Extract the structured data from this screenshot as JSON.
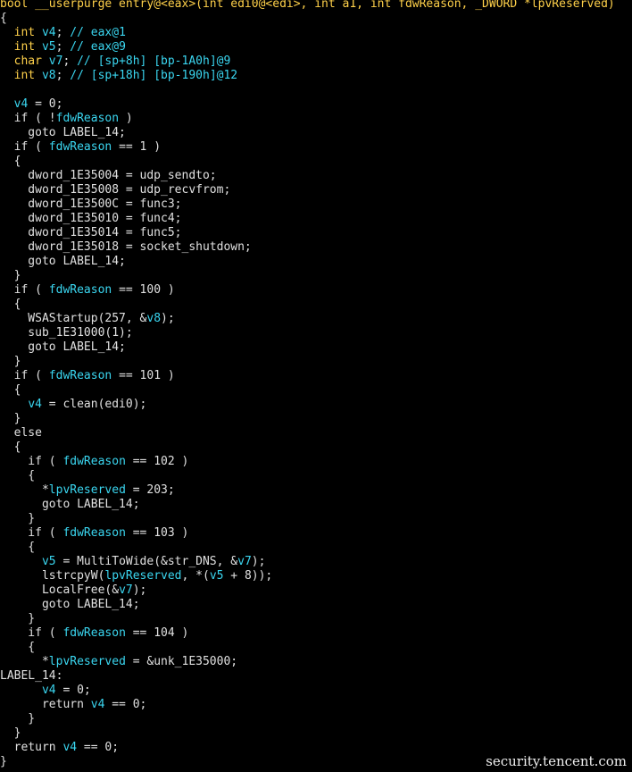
{
  "colors": {
    "background": "#000000",
    "text": "#e0e0e0",
    "type_keyword": "#ffd14a",
    "variable": "#3ad6f0"
  },
  "code_lines": [
    [
      [
        "header",
        "bool __userpurge entry@<eax>(int edi0@<edi>, int a1, int fdwReason, _DWORD *lpvReserved)"
      ]
    ],
    [
      [
        "plain",
        "{"
      ]
    ],
    [
      [
        "plain",
        "  "
      ],
      [
        "type",
        "int"
      ],
      [
        "plain",
        " "
      ],
      [
        "var",
        "v4"
      ],
      [
        "plain",
        "; "
      ],
      [
        "comment",
        "// eax@1"
      ]
    ],
    [
      [
        "plain",
        "  "
      ],
      [
        "type",
        "int"
      ],
      [
        "plain",
        " "
      ],
      [
        "var",
        "v5"
      ],
      [
        "plain",
        "; "
      ],
      [
        "comment",
        "// eax@9"
      ]
    ],
    [
      [
        "plain",
        "  "
      ],
      [
        "type",
        "char"
      ],
      [
        "plain",
        " "
      ],
      [
        "var",
        "v7"
      ],
      [
        "plain",
        "; "
      ],
      [
        "comment",
        "// [sp+8h] [bp-1A0h]@9"
      ]
    ],
    [
      [
        "plain",
        "  "
      ],
      [
        "type",
        "int"
      ],
      [
        "plain",
        " "
      ],
      [
        "var",
        "v8"
      ],
      [
        "plain",
        "; "
      ],
      [
        "comment",
        "// [sp+18h] [bp-190h]@12"
      ]
    ],
    [
      [
        "plain",
        ""
      ]
    ],
    [
      [
        "plain",
        "  "
      ],
      [
        "var",
        "v4"
      ],
      [
        "plain",
        " = 0;"
      ]
    ],
    [
      [
        "plain",
        "  if ( !"
      ],
      [
        "var",
        "fdwReason"
      ],
      [
        "plain",
        " )"
      ]
    ],
    [
      [
        "plain",
        "    goto LABEL_14;"
      ]
    ],
    [
      [
        "plain",
        "  if ( "
      ],
      [
        "var",
        "fdwReason"
      ],
      [
        "plain",
        " == 1 )"
      ]
    ],
    [
      [
        "plain",
        "  {"
      ]
    ],
    [
      [
        "plain",
        "    dword_1E35004 = udp_sendto;"
      ]
    ],
    [
      [
        "plain",
        "    dword_1E35008 = udp_recvfrom;"
      ]
    ],
    [
      [
        "plain",
        "    dword_1E3500C = func3;"
      ]
    ],
    [
      [
        "plain",
        "    dword_1E35010 = func4;"
      ]
    ],
    [
      [
        "plain",
        "    dword_1E35014 = func5;"
      ]
    ],
    [
      [
        "plain",
        "    dword_1E35018 = socket_shutdown;"
      ]
    ],
    [
      [
        "plain",
        "    goto LABEL_14;"
      ]
    ],
    [
      [
        "plain",
        "  }"
      ]
    ],
    [
      [
        "plain",
        "  if ( "
      ],
      [
        "var",
        "fdwReason"
      ],
      [
        "plain",
        " == 100 )"
      ]
    ],
    [
      [
        "plain",
        "  {"
      ]
    ],
    [
      [
        "plain",
        "    WSAStartup(257, &"
      ],
      [
        "var",
        "v8"
      ],
      [
        "plain",
        ");"
      ]
    ],
    [
      [
        "plain",
        "    sub_1E31000(1);"
      ]
    ],
    [
      [
        "plain",
        "    goto LABEL_14;"
      ]
    ],
    [
      [
        "plain",
        "  }"
      ]
    ],
    [
      [
        "plain",
        "  if ( "
      ],
      [
        "var",
        "fdwReason"
      ],
      [
        "plain",
        " == 101 )"
      ]
    ],
    [
      [
        "plain",
        "  {"
      ]
    ],
    [
      [
        "plain",
        "    "
      ],
      [
        "var",
        "v4"
      ],
      [
        "plain",
        " = clean(edi0);"
      ]
    ],
    [
      [
        "plain",
        "  }"
      ]
    ],
    [
      [
        "plain",
        "  else"
      ]
    ],
    [
      [
        "plain",
        "  {"
      ]
    ],
    [
      [
        "plain",
        "    if ( "
      ],
      [
        "var",
        "fdwReason"
      ],
      [
        "plain",
        " == 102 )"
      ]
    ],
    [
      [
        "plain",
        "    {"
      ]
    ],
    [
      [
        "plain",
        "      *"
      ],
      [
        "var",
        "lpvReserved"
      ],
      [
        "plain",
        " = 203;"
      ]
    ],
    [
      [
        "plain",
        "      goto LABEL_14;"
      ]
    ],
    [
      [
        "plain",
        "    }"
      ]
    ],
    [
      [
        "plain",
        "    if ( "
      ],
      [
        "var",
        "fdwReason"
      ],
      [
        "plain",
        " == 103 )"
      ]
    ],
    [
      [
        "plain",
        "    {"
      ]
    ],
    [
      [
        "plain",
        "      "
      ],
      [
        "var",
        "v5"
      ],
      [
        "plain",
        " = MultiToWide(&str_DNS, &"
      ],
      [
        "var",
        "v7"
      ],
      [
        "plain",
        ");"
      ]
    ],
    [
      [
        "plain",
        "      lstrcpyW("
      ],
      [
        "var",
        "lpvReserved"
      ],
      [
        "plain",
        ", *("
      ],
      [
        "var",
        "v5"
      ],
      [
        "plain",
        " + 8));"
      ]
    ],
    [
      [
        "plain",
        "      LocalFree(&"
      ],
      [
        "var",
        "v7"
      ],
      [
        "plain",
        ");"
      ]
    ],
    [
      [
        "plain",
        "      goto LABEL_14;"
      ]
    ],
    [
      [
        "plain",
        "    }"
      ]
    ],
    [
      [
        "plain",
        "    if ( "
      ],
      [
        "var",
        "fdwReason"
      ],
      [
        "plain",
        " == 104 )"
      ]
    ],
    [
      [
        "plain",
        "    {"
      ]
    ],
    [
      [
        "plain",
        "      *"
      ],
      [
        "var",
        "lpvReserved"
      ],
      [
        "plain",
        " = &unk_1E35000;"
      ]
    ],
    [
      [
        "label",
        "LABEL_14:"
      ]
    ],
    [
      [
        "plain",
        "      "
      ],
      [
        "var",
        "v4"
      ],
      [
        "plain",
        " = 0;"
      ]
    ],
    [
      [
        "plain",
        "      return "
      ],
      [
        "var",
        "v4"
      ],
      [
        "plain",
        " == 0;"
      ]
    ],
    [
      [
        "plain",
        "    }"
      ]
    ],
    [
      [
        "plain",
        "  }"
      ]
    ],
    [
      [
        "plain",
        "  return "
      ],
      [
        "var",
        "v4"
      ],
      [
        "plain",
        " == 0;"
      ]
    ],
    [
      [
        "plain",
        "}"
      ]
    ]
  ],
  "watermark": "security.tencent.com"
}
